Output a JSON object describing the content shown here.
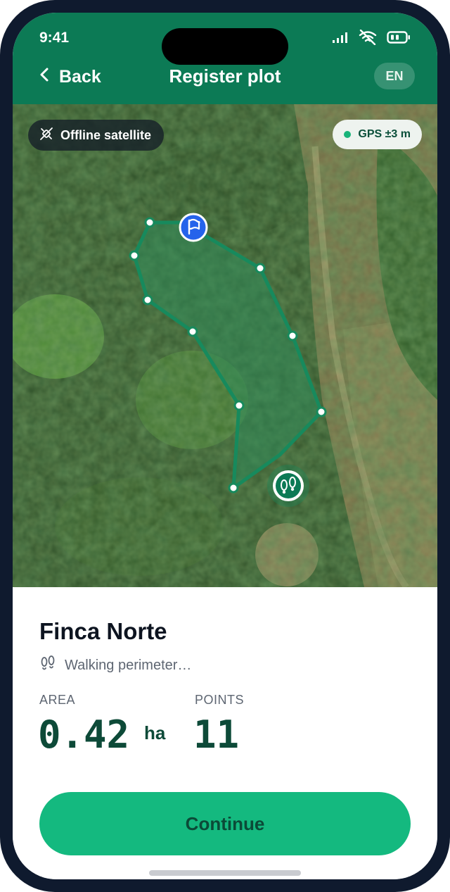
{
  "status_bar": {
    "time": "9:41"
  },
  "header": {
    "back_label": "Back",
    "title": "Register plot",
    "language": "EN"
  },
  "map": {
    "offline_badge": "Offline satellite",
    "gps_badge": "GPS ±3 m",
    "colors": {
      "polygon": "#178a5d",
      "gps_dot": "#19b47a",
      "start_marker": "#2563eb"
    }
  },
  "plot": {
    "name": "Finca Norte",
    "status": "Walking perimeter…"
  },
  "stats": {
    "area_label": "AREA",
    "area_value": "0.42",
    "area_unit": "ha",
    "points_label": "POINTS",
    "points_value": "11"
  },
  "actions": {
    "continue_label": "Continue"
  },
  "colors": {
    "brand": "#0c7a55",
    "accent": "#14b97f",
    "value_text": "#0d4a38"
  }
}
